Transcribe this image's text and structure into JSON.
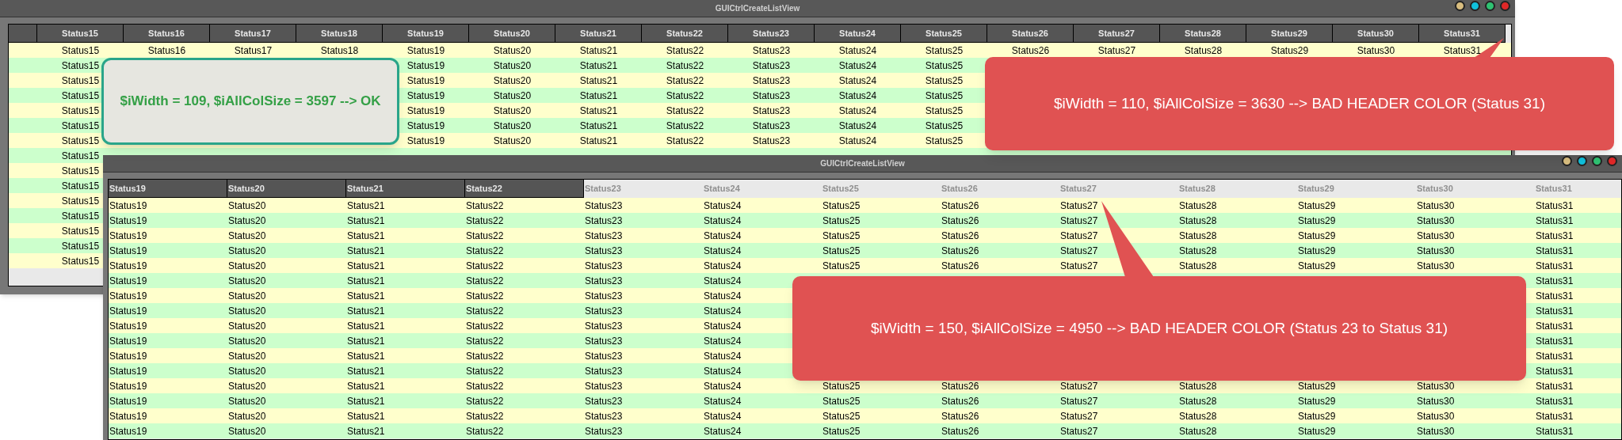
{
  "windows": [
    {
      "title": "GUICtrlCreateListView",
      "list": {
        "columns": [
          {
            "label": "Status15",
            "faded": false
          },
          {
            "label": "Status16",
            "faded": false
          },
          {
            "label": "Status17",
            "faded": false
          },
          {
            "label": "Status18",
            "faded": false
          },
          {
            "label": "Status19",
            "faded": false
          },
          {
            "label": "Status20",
            "faded": false
          },
          {
            "label": "Status21",
            "faded": false
          },
          {
            "label": "Status22",
            "faded": false
          },
          {
            "label": "Status23",
            "faded": false
          },
          {
            "label": "Status24",
            "faded": false
          },
          {
            "label": "Status25",
            "faded": false
          },
          {
            "label": "Status26",
            "faded": false
          },
          {
            "label": "Status27",
            "faded": false
          },
          {
            "label": "Status28",
            "faded": false
          },
          {
            "label": "Status29",
            "faded": false
          },
          {
            "label": "Status30",
            "faded": false
          },
          {
            "label": "Status31",
            "faded": false
          }
        ],
        "rows": [
          [
            "Status15",
            "Status16",
            "Status17",
            "Status18",
            "Status19",
            "Status20",
            "Status21",
            "Status22",
            "Status23",
            "Status24",
            "Status25",
            "Status26",
            "Status27",
            "Status28",
            "Status29",
            "Status30",
            "Status31"
          ],
          [
            "Status15",
            null,
            null,
            null,
            "Status19",
            "Status20",
            "Status21",
            "Status22",
            "Status23",
            "Status24",
            "Status25"
          ],
          [
            "Status15",
            null,
            null,
            null,
            "Status19",
            "Status20",
            "Status21",
            "Status22",
            "Status23",
            "Status24",
            "Status25"
          ],
          [
            "Status15",
            null,
            null,
            null,
            "Status19",
            "Status20",
            "Status21",
            "Status22",
            "Status23",
            "Status24",
            "Status25"
          ],
          [
            "Status15",
            null,
            null,
            null,
            "Status19",
            "Status20",
            "Status21",
            "Status22",
            "Status23",
            "Status24",
            "Status25"
          ],
          [
            "Status15",
            null,
            null,
            null,
            "Status19",
            "Status20",
            "Status21",
            "Status22",
            "Status23",
            "Status24",
            "Status25"
          ],
          [
            "Status15",
            null,
            null,
            null,
            "Status19",
            "Status20",
            "Status21",
            "Status22",
            "Status23",
            "Status24",
            "Status25"
          ],
          [
            "Status15"
          ],
          [
            "Status15"
          ],
          [
            "Status15"
          ],
          [
            "Status15"
          ],
          [
            "Status15"
          ],
          [
            "Status15"
          ],
          [
            "Status15"
          ],
          [
            "Status15"
          ]
        ]
      }
    },
    {
      "title": "GUICtrlCreateListView",
      "list": {
        "columns": [
          {
            "label": "Status19",
            "faded": false
          },
          {
            "label": "Status20",
            "faded": false
          },
          {
            "label": "Status21",
            "faded": false
          },
          {
            "label": "Status22",
            "faded": false
          },
          {
            "label": "Status23",
            "faded": true
          },
          {
            "label": "Status24",
            "faded": true
          },
          {
            "label": "Status25",
            "faded": true
          },
          {
            "label": "Status26",
            "faded": true
          },
          {
            "label": "Status27",
            "faded": true
          },
          {
            "label": "Status28",
            "faded": true
          },
          {
            "label": "Status29",
            "faded": true
          },
          {
            "label": "Status30",
            "faded": true
          },
          {
            "label": "Status31",
            "faded": true
          }
        ],
        "rows": [
          [
            "Status19",
            "Status20",
            "Status21",
            "Status22",
            "Status23",
            "Status24",
            "Status25",
            "Status26",
            "Status27",
            "Status28",
            "Status29",
            "Status30",
            "Status31"
          ],
          [
            "Status19",
            "Status20",
            "Status21",
            "Status22",
            "Status23",
            "Status24",
            "Status25",
            "Status26",
            "Status27",
            "Status28",
            "Status29",
            "Status30",
            "Status31"
          ],
          [
            "Status19",
            "Status20",
            "Status21",
            "Status22",
            "Status23",
            "Status24",
            "Status25",
            "Status26",
            "Status27",
            "Status28",
            "Status29",
            "Status30",
            "Status31"
          ],
          [
            "Status19",
            "Status20",
            "Status21",
            "Status22",
            "Status23",
            "Status24",
            "Status25",
            "Status26",
            "Status27",
            "Status28",
            "Status29",
            "Status30",
            "Status31"
          ],
          [
            "Status19",
            "Status20",
            "Status21",
            "Status22",
            "Status23",
            "Status24",
            "Status25",
            "Status26",
            "Status27",
            "Status28",
            "Status29",
            "Status30",
            "Status31"
          ],
          [
            "Status19",
            "Status20",
            "Status21",
            "Status22",
            "Status23",
            "Status24",
            null,
            null,
            null,
            null,
            null,
            null,
            "Status31"
          ],
          [
            "Status19",
            "Status20",
            "Status21",
            "Status22",
            "Status23",
            "Status24",
            null,
            null,
            null,
            null,
            null,
            null,
            "Status31"
          ],
          [
            "Status19",
            "Status20",
            "Status21",
            "Status22",
            "Status23",
            "Status24",
            null,
            null,
            null,
            null,
            null,
            null,
            "Status31"
          ],
          [
            "Status19",
            "Status20",
            "Status21",
            "Status22",
            "Status23",
            "Status24",
            null,
            null,
            null,
            null,
            null,
            null,
            "Status31"
          ],
          [
            "Status19",
            "Status20",
            "Status21",
            "Status22",
            "Status23",
            "Status24",
            null,
            null,
            null,
            null,
            null,
            null,
            "Status31"
          ],
          [
            "Status19",
            "Status20",
            "Status21",
            "Status22",
            "Status23",
            "Status24",
            null,
            null,
            null,
            null,
            null,
            null,
            "Status31"
          ],
          [
            "Status19",
            "Status20",
            "Status21",
            "Status22",
            "Status23",
            "Status24",
            null,
            null,
            null,
            null,
            null,
            null,
            "Status31"
          ],
          [
            "Status19",
            "Status20",
            "Status21",
            "Status22",
            "Status23",
            "Status24",
            "Status25",
            "Status26",
            "Status27",
            "Status28",
            "Status29",
            "Status30",
            "Status31"
          ],
          [
            "Status19",
            "Status20",
            "Status21",
            "Status22",
            "Status23",
            "Status24",
            "Status25",
            "Status26",
            "Status27",
            "Status28",
            "Status29",
            "Status30",
            "Status31"
          ],
          [
            "Status19",
            "Status20",
            "Status21",
            "Status22",
            "Status23",
            "Status24",
            "Status25",
            "Status26",
            "Status27",
            "Status28",
            "Status29",
            "Status30",
            "Status31"
          ],
          [
            "Status19",
            "Status20",
            "Status21",
            "Status22",
            "Status23",
            "Status24",
            "Status25",
            "Status26",
            "Status27",
            "Status28",
            "Status29",
            "Status30",
            "Status31"
          ]
        ]
      }
    }
  ],
  "callouts": [
    {
      "kind": "ok",
      "text": "$iWidth = 109, $iAllColSize = 3597 --> OK"
    },
    {
      "kind": "error",
      "text": "$iWidth = 110, $iAllColSize = 3630 --> BAD HEADER COLOR (Status 31)"
    },
    {
      "kind": "error",
      "text": "$iWidth = 150, $iAllColSize = 4950 --> BAD HEADER COLOR (Status 23 to Status 31)"
    }
  ]
}
